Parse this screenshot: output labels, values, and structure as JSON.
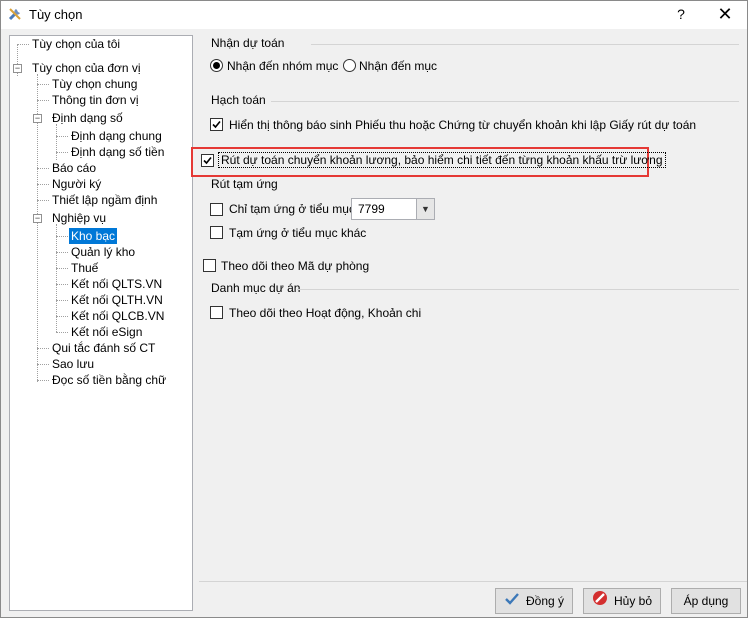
{
  "window": {
    "title": "Tùy chọn",
    "help_label": "?",
    "close_label": "✕"
  },
  "tree": {
    "items": [
      {
        "label": "Tùy chọn của tôi"
      },
      {
        "label": "Tùy chọn của đơn vị"
      },
      {
        "label": "Tùy chọn chung"
      },
      {
        "label": "Thông tin đơn vị"
      },
      {
        "label": "Định dạng số"
      },
      {
        "label": "Định dạng chung"
      },
      {
        "label": "Định dạng số tiền"
      },
      {
        "label": "Báo cáo"
      },
      {
        "label": "Người ký"
      },
      {
        "label": "Thiết lập ngầm định"
      },
      {
        "label": "Nghiệp vụ"
      },
      {
        "label": "Kho bạc",
        "selected": true
      },
      {
        "label": "Quản lý kho"
      },
      {
        "label": "Thuế"
      },
      {
        "label": "Kết nối QLTS.VN"
      },
      {
        "label": "Kết nối QLTH.VN"
      },
      {
        "label": "Kết nối QLCB.VN"
      },
      {
        "label": "Kết nối eSign"
      },
      {
        "label": "Qui tắc đánh số CT"
      },
      {
        "label": "Sao lưu"
      },
      {
        "label": "Đọc số tiền bằng chữ"
      }
    ]
  },
  "content": {
    "nhan_du_toan": {
      "title": "Nhận dự toán",
      "option1": "Nhận đến nhóm mục",
      "option2": "Nhận đến mục",
      "selected": "option1"
    },
    "hach_toan": {
      "title": "Hạch toán",
      "checkbox1": "Hiển thị thông báo sinh Phiếu thu hoặc Chứng từ chuyển khoản khi lập Giấy rút dự toán",
      "checkbox2": "Rút dự toán chuyển khoản lương, bảo hiểm chi tiết đến từng khoản khấu trừ lương"
    },
    "rut_tam_ung": {
      "title": "Rút tạm ứng",
      "checkbox1": "Chỉ tạm ứng ở tiểu mục",
      "select_value": "7799",
      "checkbox2": "Tạm ứng ở tiểu mục khác"
    },
    "theo_doi_ma_du_phong": "Theo dõi theo Mã dự phòng",
    "danh_muc_du_an": {
      "title": "Danh mục dự án",
      "checkbox1": "Theo dõi theo Hoạt động, Khoản chi"
    }
  },
  "buttons": {
    "ok": "Đồng ý",
    "cancel": "Hủy bỏ",
    "apply": "Áp dụng"
  },
  "colors": {
    "selection": "#0078d7",
    "highlight_border": "#e53935"
  }
}
